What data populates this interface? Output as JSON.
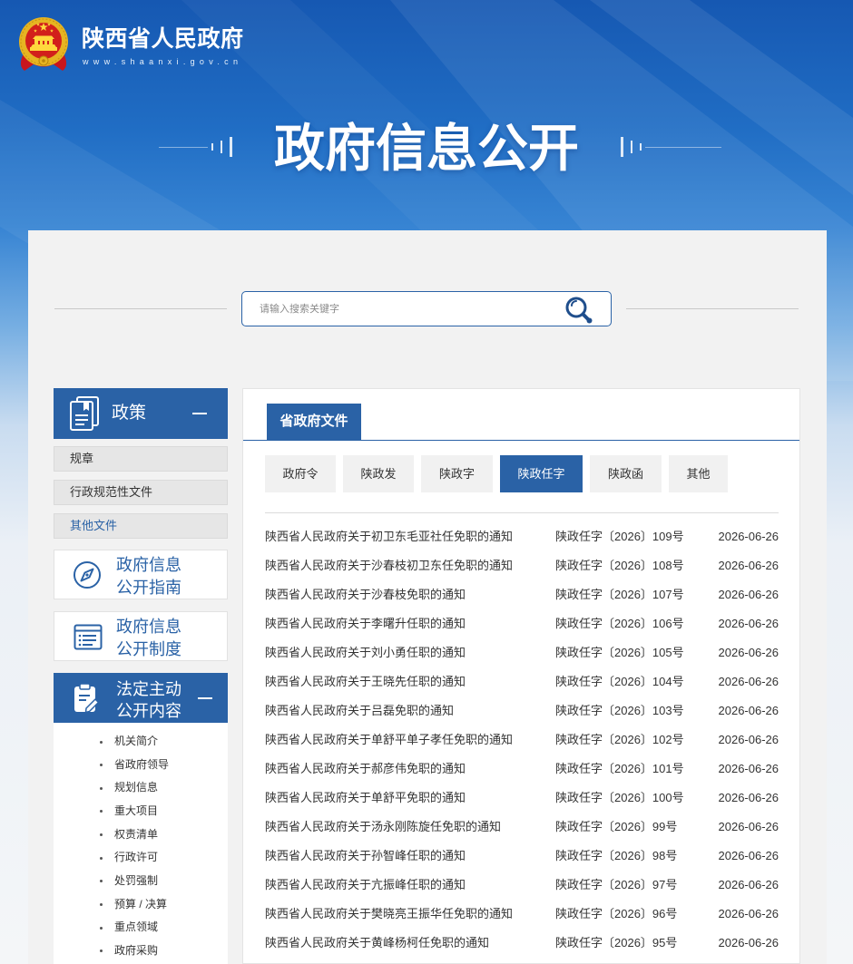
{
  "site": {
    "name": "陕西省人民政府",
    "domain": "www.shaanxi.gov.cn",
    "emblem_icon": "national-emblem-icon"
  },
  "banner": {
    "title": "政府信息公开"
  },
  "search": {
    "placeholder": "请输入搜索关键字",
    "icon": "search-icon"
  },
  "sidebar": {
    "policy": {
      "label": "政策",
      "icon": "document-icon",
      "collapse_icon": "minus-icon",
      "items": [
        {
          "label": "规章",
          "active": false
        },
        {
          "label": "行政规范性文件",
          "active": false
        },
        {
          "label": "其他文件",
          "active": true
        }
      ]
    },
    "guide": {
      "line1": "政府信息",
      "line2": "公开指南",
      "icon": "compass-icon"
    },
    "system": {
      "line1": "政府信息",
      "line2": "公开制度",
      "icon": "list-document-icon"
    },
    "statutory": {
      "line1": "法定主动",
      "line2": "公开内容",
      "icon": "clipboard-edit-icon",
      "collapse_icon": "minus-icon",
      "items": [
        {
          "label": "机关简介"
        },
        {
          "label": "省政府领导"
        },
        {
          "label": "规划信息"
        },
        {
          "label": "重大项目"
        },
        {
          "label": "权责清单"
        },
        {
          "label": "行政许可"
        },
        {
          "label": "处罚强制"
        },
        {
          "label": "预算 / 决算"
        },
        {
          "label": "重点领域"
        },
        {
          "label": "政府采购"
        }
      ]
    }
  },
  "main": {
    "tab": "省政府文件",
    "filters": [
      {
        "label": "政府令",
        "active": false
      },
      {
        "label": "陕政发",
        "active": false
      },
      {
        "label": "陕政字",
        "active": false
      },
      {
        "label": "陕政任字",
        "active": true
      },
      {
        "label": "陕政函",
        "active": false
      },
      {
        "label": "其他",
        "active": false
      }
    ],
    "documents": [
      {
        "title": "陕西省人民政府关于初卫东毛亚社任免职的通知",
        "number": "陕政任字〔2026〕109号",
        "date": "2026-06-26"
      },
      {
        "title": "陕西省人民政府关于沙春枝初卫东任免职的通知",
        "number": "陕政任字〔2026〕108号",
        "date": "2026-06-26"
      },
      {
        "title": "陕西省人民政府关于沙春枝免职的通知",
        "number": "陕政任字〔2026〕107号",
        "date": "2026-06-26"
      },
      {
        "title": "陕西省人民政府关于李曙升任职的通知",
        "number": "陕政任字〔2026〕106号",
        "date": "2026-06-26"
      },
      {
        "title": "陕西省人民政府关于刘小勇任职的通知",
        "number": "陕政任字〔2026〕105号",
        "date": "2026-06-26"
      },
      {
        "title": "陕西省人民政府关于王晓先任职的通知",
        "number": "陕政任字〔2026〕104号",
        "date": "2026-06-26"
      },
      {
        "title": "陕西省人民政府关于吕磊免职的通知",
        "number": "陕政任字〔2026〕103号",
        "date": "2026-06-26"
      },
      {
        "title": "陕西省人民政府关于单舒平单子孝任免职的通知",
        "number": "陕政任字〔2026〕102号",
        "date": "2026-06-26"
      },
      {
        "title": "陕西省人民政府关于郝彦伟免职的通知",
        "number": "陕政任字〔2026〕101号",
        "date": "2026-06-26"
      },
      {
        "title": "陕西省人民政府关于单舒平免职的通知",
        "number": "陕政任字〔2026〕100号",
        "date": "2026-06-26"
      },
      {
        "title": "陕西省人民政府关于汤永刚陈旋任免职的通知",
        "number": "陕政任字〔2026〕99号",
        "date": "2026-06-26"
      },
      {
        "title": "陕西省人民政府关于孙智峰任职的通知",
        "number": "陕政任字〔2026〕98号",
        "date": "2026-06-26"
      },
      {
        "title": "陕西省人民政府关于亢振峰任职的通知",
        "number": "陕政任字〔2026〕97号",
        "date": "2026-06-26"
      },
      {
        "title": "陕西省人民政府关于樊晓亮王振华任免职的通知",
        "number": "陕政任字〔2026〕96号",
        "date": "2026-06-26"
      },
      {
        "title": "陕西省人民政府关于黄峰杨柯任免职的通知",
        "number": "陕政任字〔2026〕95号",
        "date": "2026-06-26"
      }
    ]
  },
  "colors": {
    "primary": "#2a62a6",
    "content_bg": "#f2f2f2",
    "text": "#333333",
    "filter_bg": "#f1f1f1",
    "sub_bg": "#e6e6e6"
  }
}
